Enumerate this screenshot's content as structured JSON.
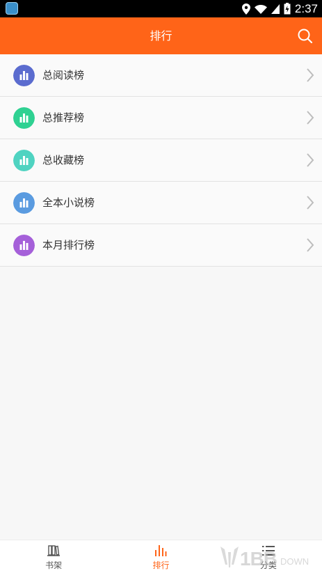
{
  "status_bar": {
    "time": "2:37"
  },
  "header": {
    "title": "排行"
  },
  "rankings": [
    {
      "label": "总阅读榜",
      "color": "#5b6ccf"
    },
    {
      "label": "总推荐榜",
      "color": "#2fd192"
    },
    {
      "label": "总收藏榜",
      "color": "#4fd3c1"
    },
    {
      "label": "全本小说榜",
      "color": "#5a9be0"
    },
    {
      "label": "本月排行榜",
      "color": "#a560d9"
    }
  ],
  "bottom_nav": [
    {
      "label": "书架",
      "icon": "bookshelf-icon",
      "active": false
    },
    {
      "label": "排行",
      "icon": "ranking-icon",
      "active": true
    },
    {
      "label": "分类",
      "icon": "category-list-icon",
      "active": false
    }
  ],
  "watermark": {
    "text": "1BB",
    "sub": "DOWN"
  },
  "colors": {
    "accent": "#ff6418"
  }
}
